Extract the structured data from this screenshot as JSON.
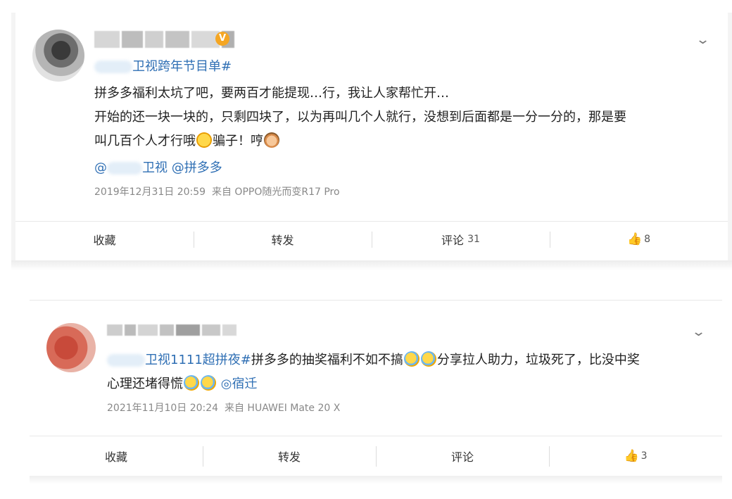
{
  "posts": [
    {
      "topic_suffix": "卫视跨年节目单#",
      "text_lines": [
        "拼多多福利太坑了吧，要两百才能提现…行，我让人家帮忙开…",
        "开始的还一块一块的，只剩四块了，以为再叫几个人就行，没想到后面都是一分一分的，那是要",
        "叫几百个人才行哦"
      ],
      "line3_mid": "骗子！哼",
      "mention_1_prefix": "@",
      "mention_1_suffix": "卫视",
      "mention_2": "@拼多多",
      "timestamp": "2019年12月31日 20:59",
      "source": "来自 OPPO随光而变R17 Pro",
      "actions": {
        "favorite": "收藏",
        "repost": "转发",
        "comment": "评论",
        "comment_count": "31",
        "like_count": "8"
      },
      "icons": [
        "verified-badge-icon",
        "chevron-down-icon",
        "sweat-smile-emoji-icon",
        "cat-emoji-icon",
        "thumbs-up-icon"
      ]
    },
    {
      "topic_suffix": "卫视1111超拼夜#",
      "line1_text": "拼多多的抽奖福利不如不搞",
      "line1_tail": "分享拉人助力，垃圾死了，比没中奖",
      "line2_text": "心理还堵得慌",
      "location": "◎宿迁",
      "timestamp": "2021年11月10日 20:24",
      "source": "来自 HUAWEI Mate 20 X",
      "actions": {
        "favorite": "收藏",
        "repost": "转发",
        "comment": "评论",
        "like_count": "3"
      },
      "icons": [
        "chevron-down-icon",
        "crying-laugh-emoji-icon",
        "thumbs-up-icon"
      ]
    }
  ],
  "colors": {
    "link": "#2f6fb4",
    "verified": "#f5a623",
    "meta_text": "#888888"
  }
}
